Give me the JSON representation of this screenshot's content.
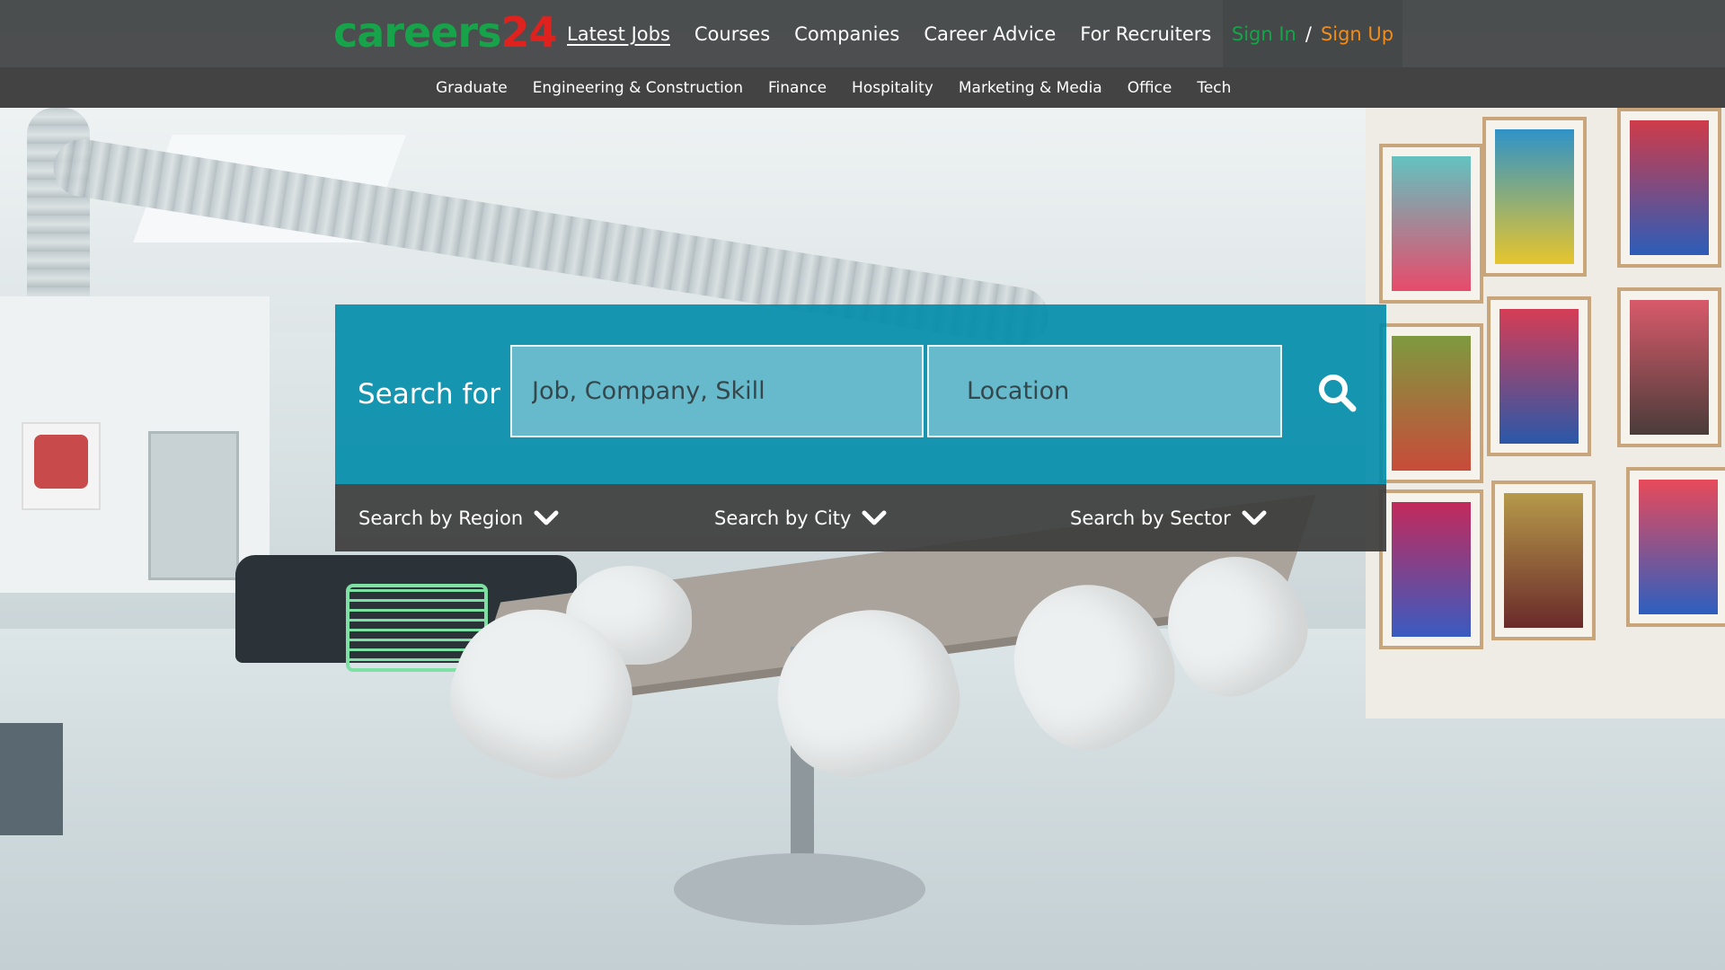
{
  "header": {
    "logo_text_green": "careers",
    "logo_text_red": "24",
    "nav": [
      {
        "label": "Latest Jobs",
        "active": true
      },
      {
        "label": "Courses",
        "active": false
      },
      {
        "label": "Companies",
        "active": false
      },
      {
        "label": "Career Advice",
        "active": false
      },
      {
        "label": "For Recruiters",
        "active": false
      }
    ],
    "auth": {
      "sign_in": "Sign In",
      "separator": "/",
      "sign_up": "Sign Up"
    }
  },
  "subnav": [
    "Graduate",
    "Engineering & Construction",
    "Finance",
    "Hospitality",
    "Marketing & Media",
    "Office",
    "Tech"
  ],
  "search": {
    "label": "Search for",
    "job_placeholder": "Job, Company, Skill",
    "location_placeholder": "Location",
    "button_icon": "search-icon"
  },
  "filters": {
    "region": "Search by Region",
    "city": "Search by City",
    "sector": "Search by Sector",
    "icon": "chevron-down-icon"
  },
  "colors": {
    "brand_green": "#17a34a",
    "brand_red": "#e0221f",
    "sign_up_orange": "#f28c1b",
    "search_panel": "#008caa",
    "dark_bar": "#3c3c3c"
  }
}
